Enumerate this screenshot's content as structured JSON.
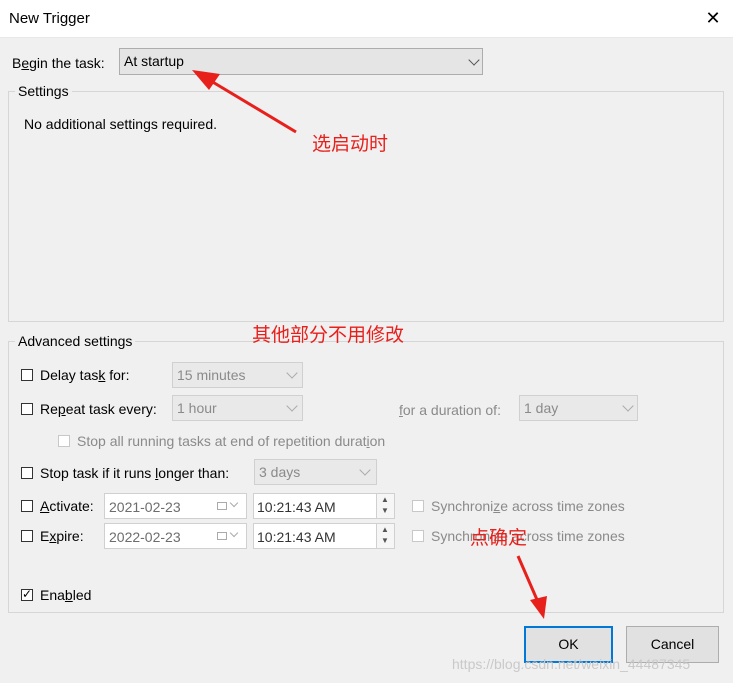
{
  "window": {
    "title": "New Trigger",
    "close_glyph": "✕"
  },
  "begin": {
    "label_pre": "B",
    "label_key": "e",
    "label_post": "gin the task:",
    "selected": "At startup"
  },
  "settings": {
    "legend": "Settings",
    "message": "No additional settings required."
  },
  "advanced": {
    "legend": "Advanced settings",
    "delay": {
      "pre": "Delay tas",
      "key": "k",
      "post": " for:",
      "value": "15 minutes",
      "checked": false
    },
    "repeat": {
      "pre": "Re",
      "key": "p",
      "post": "eat task every:",
      "value": "1 hour",
      "checked": false,
      "duration_pre": "",
      "duration_key": "f",
      "duration_post": "or a duration of:",
      "duration_value": "1 day"
    },
    "stop_running": {
      "pre": "Stop all running tasks at end of repetition durat",
      "key": "i",
      "post": "on",
      "checked": false
    },
    "stop_longer": {
      "pre": "Stop task if it runs ",
      "key": "l",
      "post": "onger than:",
      "value": "3 days",
      "checked": false
    },
    "activate": {
      "pre": "",
      "key": "A",
      "post": "ctivate:",
      "date": "2021-02-23",
      "time": "10:21:43 AM",
      "checked": false,
      "sync_pre": "Synchroni",
      "sync_key": "z",
      "sync_post": "e across time zones"
    },
    "expire": {
      "pre": "E",
      "key": "x",
      "post": "pire:",
      "date": "2022-02-23",
      "time": "10:21:43 AM",
      "checked": false,
      "sync_pre": "Synchronize across time zones"
    },
    "enabled": {
      "pre": "Ena",
      "key": "b",
      "post": "led",
      "checked": true
    }
  },
  "buttons": {
    "ok": "OK",
    "cancel": "Cancel"
  },
  "annotations": {
    "a1": "选启动时",
    "a2": "其他部分不用修改",
    "a3": "点确定",
    "color": "#e8201c"
  },
  "watermark": "https://blog.csdn.net/weixin_44487345",
  "colors": {
    "dialog_bg": "#f0f0f0",
    "ok_border": "#0078d7"
  }
}
